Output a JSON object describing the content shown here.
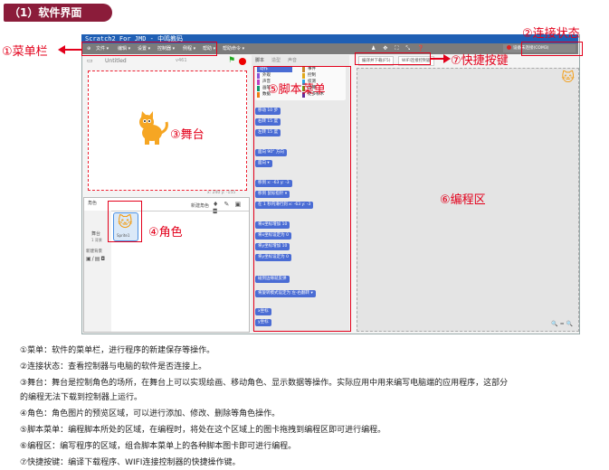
{
  "section_title": "（1）软件界面",
  "window_title": "Scratch2 For JMD - 中鸣教码",
  "menu": [
    "文件 ▾",
    "编辑 ▾",
    "设置 ▾",
    "控制器 ▾",
    "例程 ▾",
    "帮助 ▾",
    "帮助命令 ▾"
  ],
  "toolbar_icons": "♟ ✥ ⛶ ⤡ ❓",
  "connection": {
    "text": "设备未连接(COM3)"
  },
  "stage": {
    "name": "Untitled",
    "version": "v461"
  },
  "sprite_panel": {
    "new_sprite_label": "新建角色",
    "coords": "x: 240  y: -155",
    "stage_label": "舞台",
    "backdrops": "1 背景",
    "new_backdrop": "新建背景",
    "sprite_header": "角色",
    "sprite_name": "Sprite1"
  },
  "block_tabs": [
    "脚本",
    "造型",
    "声音"
  ],
  "categories_left": [
    "动作",
    "外观",
    "声音",
    "画笔",
    "数据"
  ],
  "categories_right": [
    "事件",
    "控制",
    "侦测",
    "运算",
    "更多积木"
  ],
  "blocks": [
    "移动 10 步",
    "右转 15 度",
    "左转 15 度",
    "面向 90° 方向",
    "面向 ▾",
    "移到 x: -63 y: -3",
    "移到 鼠标指针 ▾",
    "在 1 秒内滑行到 x: -63 y: -3",
    "将x坐标增加 10",
    "将x坐标设定为 0",
    "将y坐标增加 10",
    "将y坐标设定为 0",
    "碰到边缘就反弹",
    "将旋转模式设定为 左-右翻转 ▾",
    "x坐标",
    "y坐标"
  ],
  "quick_keys": [
    "编译并下载(F5)",
    "WIFI连接控制器"
  ],
  "zoom": "🔍 = 🔍",
  "labels": {
    "menubar": "①菜单栏",
    "connection": "②连接状态",
    "stage": "③舞台",
    "sprite": "④角色",
    "blocks": "⑤脚本菜单",
    "script": "⑥编程区",
    "quick": "⑦快捷按键"
  },
  "descriptions": [
    "①菜单：软件的菜单栏，进行程序的新建保存等操作。",
    "②连接状态：查看控制器与电脑的软件是否连接上。",
    "③舞台：舞台是控制角色的场所，在舞台上可以实现绘画、移动角色、显示数据等操作。实际应用中用来编写电脑端的应用程序，这部分",
    "的编程无法下载到控制器上运行。",
    "④角色：角色图片的预览区域，可以进行添加、修改、删除等角色操作。",
    "⑤脚本菜单：编程脚本所处的区域，在编程时，将处在这个区域上的图卡拖拽到编程区即可进行编程。",
    "⑥编程区：编写程序的区域，组合脚本菜单上的各种脚本图卡即可进行编程。",
    "⑦快捷按键：编译下载程序、WIFI连接控制器的快捷操作键。"
  ],
  "colors": {
    "annotation": "#e3001b",
    "header": "#8b1c3a",
    "titlebar": "#1f5fb4",
    "motion_block": "#4a6cd4"
  }
}
